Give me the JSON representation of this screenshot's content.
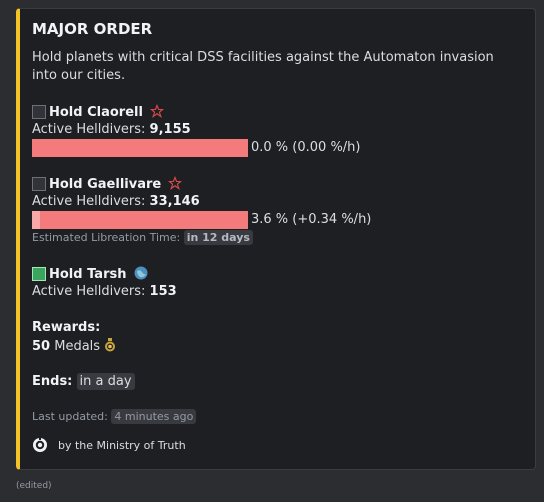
{
  "embed": {
    "title": "MAJOR ORDER",
    "description": "Hold planets with critical DSS facilities against the Automaton invasion into our cities.",
    "accent_color": "#f2c227",
    "planets": [
      {
        "name": "Hold Claorell",
        "checked": false,
        "faction_icon": "automaton-icon",
        "helldivers_label": "Active Helldivers:",
        "helldivers": "9,155",
        "progress_percent": 0.0,
        "progress_text": "0.0 % (0.00 %/h)"
      },
      {
        "name": "Hold Gaellivare",
        "checked": false,
        "faction_icon": "automaton-icon",
        "helldivers_label": "Active Helldivers:",
        "helldivers": "33,146",
        "progress_percent": 3.6,
        "progress_text": "3.6 % (+0.34 %/h)",
        "liberation_label": "Estimated Libreation Time:",
        "liberation_value": "in 12 days"
      },
      {
        "name": "Hold Tarsh",
        "checked": true,
        "faction_icon": "planet-icon",
        "helldivers_label": "Active Helldivers:",
        "helldivers": "153"
      }
    ],
    "rewards_label": "Rewards:",
    "rewards_amount": "50",
    "rewards_unit": "Medals",
    "ends_label": "Ends:",
    "ends_value": "in a day",
    "last_updated_label": "Last updated:",
    "last_updated_value": "4 minutes ago",
    "footer_text": "by the Ministry of Truth"
  },
  "message": {
    "edited": "(edited)"
  }
}
